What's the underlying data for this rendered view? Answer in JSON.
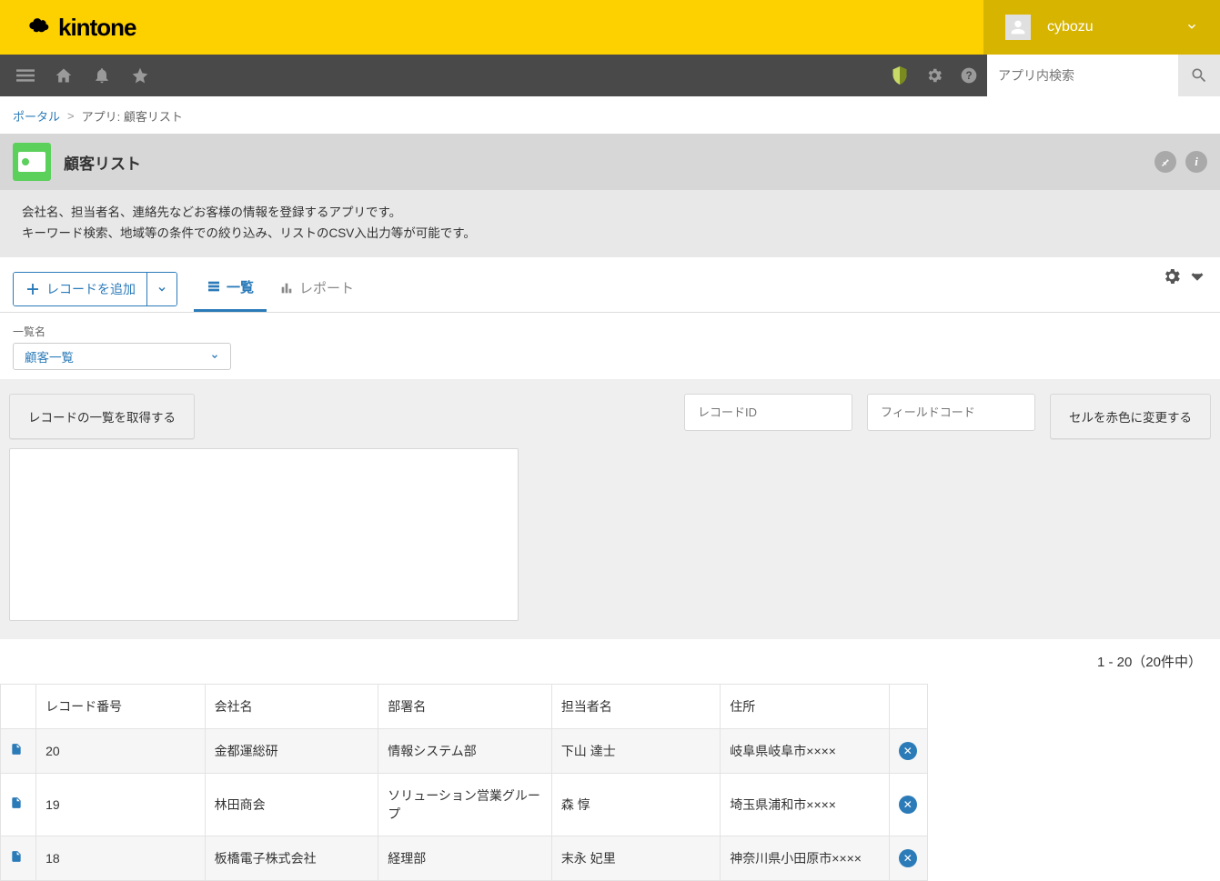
{
  "brand": "kintone",
  "user": {
    "name": "cybozu"
  },
  "search": {
    "placeholder": "アプリ内検索"
  },
  "breadcrumb": {
    "portal": "ポータル",
    "sep": ">",
    "current": "アプリ: 顧客リスト"
  },
  "app": {
    "title": "顧客リスト",
    "desc1": "会社名、担当者名、連絡先などお客様の情報を登録するアプリです。",
    "desc2": "キーワード検索、地域等の条件での絞り込み、リストのCSV入出力等が可能です。"
  },
  "toolbar": {
    "add_label": "レコードを追加",
    "tab_list": "一覧",
    "tab_report": "レポート"
  },
  "list_select": {
    "label": "一覧名",
    "value": "顧客一覧"
  },
  "custom": {
    "fetch_btn": "レコードの一覧を取得する",
    "rec_id_placeholder": "レコードID",
    "field_code_placeholder": "フィールドコード",
    "change_btn": "セルを赤色に変更する"
  },
  "pager": "1 - 20（20件中）",
  "table": {
    "headers": [
      "レコード番号",
      "会社名",
      "部署名",
      "担当者名",
      "住所"
    ],
    "rows": [
      {
        "num": "20",
        "company": "金都運総研",
        "dept": "情報システム部",
        "person": "下山 達士",
        "addr": "岐阜県岐阜市××××"
      },
      {
        "num": "19",
        "company": "林田商会",
        "dept": "ソリューション営業グループ",
        "person": "森 惇",
        "addr": "埼玉県浦和市××××"
      },
      {
        "num": "18",
        "company": "板橋電子株式会社",
        "dept": "経理部",
        "person": "末永 妃里",
        "addr": "神奈川県小田原市××××"
      }
    ]
  }
}
